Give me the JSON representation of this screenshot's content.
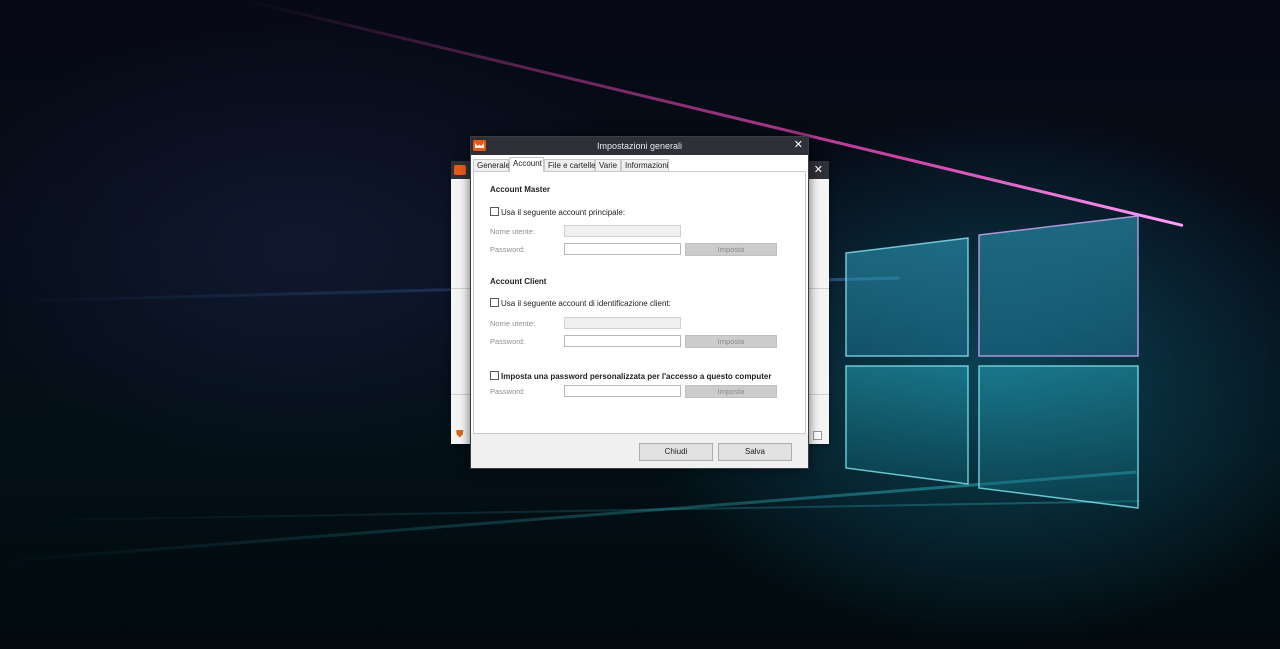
{
  "dialog": {
    "title": "Impostazioni generali",
    "close_glyph": "✕",
    "tabs": [
      {
        "label": "Generale"
      },
      {
        "label": "Account"
      },
      {
        "label": "File e cartelle"
      },
      {
        "label": "Varie"
      },
      {
        "label": "Informazioni"
      }
    ],
    "active_tab": "Account",
    "master": {
      "heading": "Account Master",
      "checkbox_label": "Usa il seguente account principale:",
      "checked": false,
      "username_label": "Nome utente:",
      "username_value": "",
      "password_label": "Password:",
      "password_value": "",
      "set_button": "Imposta"
    },
    "client": {
      "heading": "Account Client",
      "checkbox_label": "Usa il seguente account di identificazione client:",
      "checked": false,
      "username_label": "Nome utente:",
      "username_value": "",
      "password_label": "Password:",
      "password_value": "",
      "set_button": "Imposta"
    },
    "custom": {
      "checkbox_label": "Imposta una password personalizzata per l'accesso a questo computer",
      "checked": false,
      "password_label": "Password:",
      "password_value": "",
      "set_button": "Imposta"
    },
    "footer": {
      "close_button": "Chiudi",
      "save_button": "Salva"
    }
  },
  "background_window": {
    "close_glyph": "✕",
    "status_icon": "shield-icon"
  },
  "colors": {
    "titlebar": "#2e3037",
    "app_icon": "#e35b1c"
  }
}
